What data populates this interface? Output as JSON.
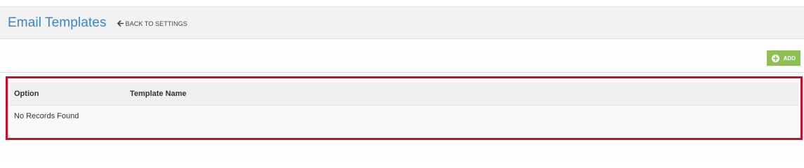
{
  "header": {
    "title": "Email Templates",
    "back_link_label": "BACK TO SETTINGS"
  },
  "toolbar": {
    "add_label": "ADD"
  },
  "table": {
    "columns": [
      "Option",
      "Template Name"
    ],
    "empty_message": "No Records Found"
  },
  "icons": {
    "back": "arrow-left-icon",
    "add": "plus-circle-icon"
  },
  "colors": {
    "title": "#3a86c8",
    "add_button": "#8cc152",
    "highlight_border": "#c8102e"
  }
}
